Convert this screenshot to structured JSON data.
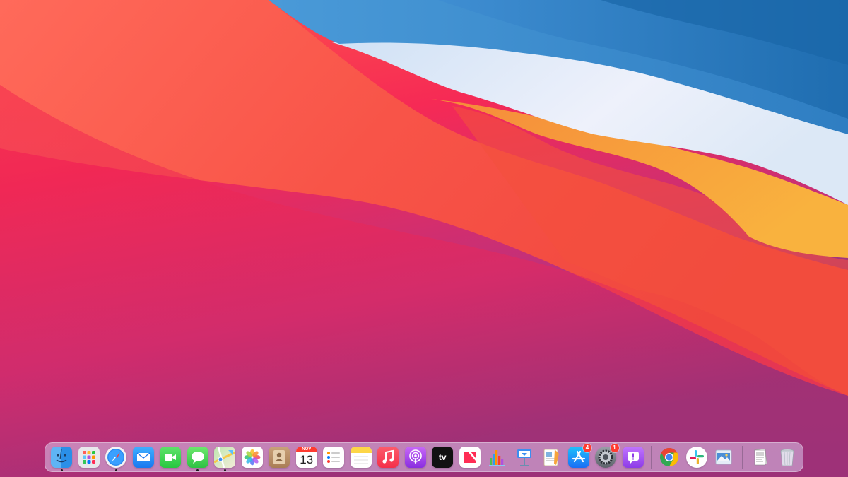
{
  "desktop": {
    "wallpaper": "Big Sur wave"
  },
  "dock": {
    "apps": [
      {
        "name": "finder-icon",
        "running": true
      },
      {
        "name": "launchpad-icon",
        "running": false
      },
      {
        "name": "safari-icon",
        "running": true
      },
      {
        "name": "mail-icon",
        "running": false
      },
      {
        "name": "facetime-icon",
        "running": false
      },
      {
        "name": "messages-icon",
        "running": true
      },
      {
        "name": "maps-icon",
        "running": true
      },
      {
        "name": "photos-icon",
        "running": false
      },
      {
        "name": "contacts-icon",
        "running": false
      },
      {
        "name": "calendar-icon",
        "running": false,
        "month": "NOV",
        "day": "13"
      },
      {
        "name": "reminders-icon",
        "running": false
      },
      {
        "name": "notes-icon",
        "running": false
      },
      {
        "name": "music-icon",
        "running": false
      },
      {
        "name": "podcasts-icon",
        "running": false
      },
      {
        "name": "tv-icon",
        "running": false,
        "label": "tv"
      },
      {
        "name": "news-icon",
        "running": false
      },
      {
        "name": "numbers-icon",
        "running": false
      },
      {
        "name": "keynote-icon",
        "running": false
      },
      {
        "name": "pages-icon",
        "running": false
      },
      {
        "name": "app-store-icon",
        "running": false,
        "badge": "4"
      },
      {
        "name": "system-preferences-icon",
        "running": false,
        "badge": "1"
      },
      {
        "name": "feedback-assistant-icon",
        "running": false
      }
    ],
    "other_apps": [
      {
        "name": "chrome-icon",
        "running": false
      },
      {
        "name": "slack-icon",
        "running": false
      },
      {
        "name": "preview-icon",
        "running": false
      }
    ],
    "stacks": [
      {
        "name": "documents-stack-icon"
      },
      {
        "name": "trash-icon"
      }
    ],
    "colors": {
      "accent": "#007aff",
      "badge": "#ff3b30"
    }
  }
}
